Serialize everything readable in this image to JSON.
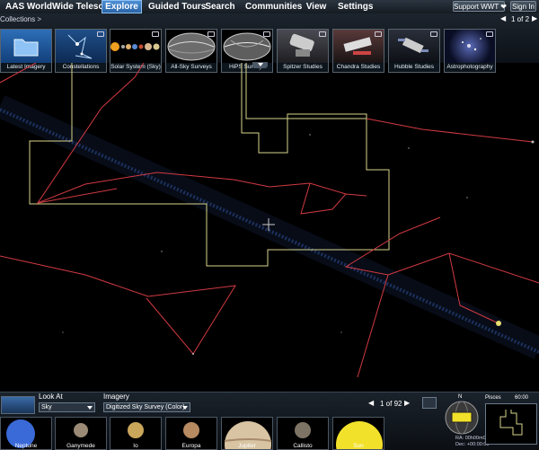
{
  "app_title": "AAS WorldWide Telescope",
  "menu": [
    "Explore",
    "Guided Tours",
    "Search",
    "Communities",
    "View",
    "Settings"
  ],
  "support_label": "Support WWT ❤",
  "signin_label": "Sign In",
  "breadcrumb": "Collections >",
  "page_indicator": "1 of 2",
  "collections": [
    {
      "label": "Latest Imagery",
      "icon": "folder-icon"
    },
    {
      "label": "Constellations",
      "icon": "constellation-icon"
    },
    {
      "label": "Solar System (Sky)",
      "icon": "planets-icon"
    },
    {
      "label": "All-Sky Surveys",
      "icon": "sky-map-icon"
    },
    {
      "label": "HiPS Surveys",
      "icon": "sky-map-icon"
    },
    {
      "label": "Spitzer Studies",
      "icon": "telescope-icon"
    },
    {
      "label": "Chandra Studies",
      "icon": "telescope-icon"
    },
    {
      "label": "Hubble Studies",
      "icon": "telescope-icon"
    },
    {
      "label": "Astrophotography",
      "icon": "galaxy-icon"
    }
  ],
  "look_at_label": "Look At",
  "look_at_value": "Sky",
  "imagery_label": "Imagery",
  "imagery_value": "Digitized Sky Survey (Color)",
  "context_page": "1 of 92",
  "context_items": [
    {
      "label": "Neptune",
      "color": "#3a6ad8"
    },
    {
      "label": "Ganymede",
      "color": "#9a8a76"
    },
    {
      "label": "Io",
      "color": "#c9a65a"
    },
    {
      "label": "Europa",
      "color": "#b88a62"
    },
    {
      "label": "Jupiter",
      "color": "#d8c4a2"
    },
    {
      "label": "Callisto",
      "color": "#7e7466"
    },
    {
      "label": "Sun",
      "color": "#f2e12a"
    }
  ],
  "ra_label": "RA: 00h00m00.0s",
  "dec_label": "Dec: +00:00:00",
  "constellation_name": "Pisces",
  "fov_label": "60:00",
  "compass_label": "N",
  "colors": {
    "boundary": "#d8d38a",
    "figure": "#d13a42",
    "milky_way": "#2b4a8c",
    "accent": "#3a7ccc"
  }
}
